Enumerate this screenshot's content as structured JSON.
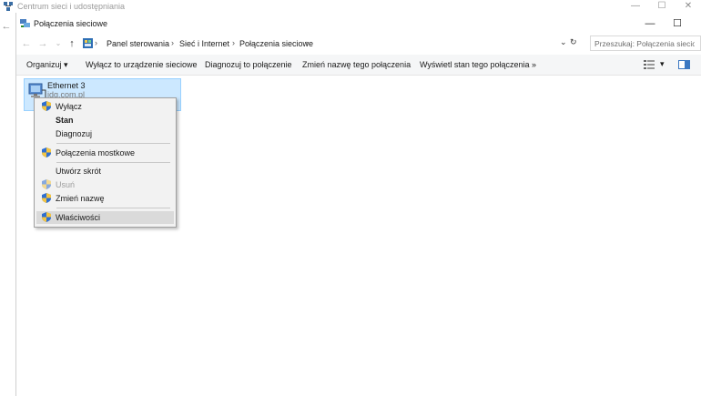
{
  "background_window": {
    "title": "Centrum sieci i udostępniania",
    "controls": [
      "—",
      "☐",
      "✕"
    ],
    "back": "←"
  },
  "window": {
    "title": "Połączenia sieciowe",
    "controls": [
      "—",
      "☐"
    ]
  },
  "nav": {
    "back": "←",
    "forward": "→",
    "recent": "⌄",
    "up": "↑"
  },
  "address": {
    "breadcrumbs": [
      "Panel sterowania",
      "Sieć i Internet",
      "Połączenia sieciowe"
    ],
    "separator": "›",
    "dropdown": "⌄",
    "refresh": "↻"
  },
  "search": {
    "placeholder": "Przeszukaj: Połączenia sieciowe"
  },
  "commandbar": {
    "organize": "Organizuj ▾",
    "items": [
      "Wyłącz to urządzenie sieciowe",
      "Diagnozuj to połączenie",
      "Zmień nazwę tego połączenia",
      "Wyświetl stan tego połączenia"
    ],
    "more": "»",
    "view_menu": "▾"
  },
  "connection": {
    "name": "Ethernet 3",
    "network": "idg.com.pl"
  },
  "context_menu": {
    "items": [
      {
        "label": "Wyłącz",
        "shield": true,
        "bold": false,
        "disabled": false
      },
      {
        "label": "Stan",
        "shield": false,
        "bold": true,
        "disabled": false
      },
      {
        "label": "Diagnozuj",
        "shield": false,
        "bold": false,
        "disabled": false
      },
      {
        "label": "Połączenia mostkowe",
        "shield": true,
        "bold": false,
        "disabled": false
      },
      {
        "label": "Utwórz skrót",
        "shield": false,
        "bold": false,
        "disabled": false
      },
      {
        "label": "Usuń",
        "shield": true,
        "bold": false,
        "disabled": true
      },
      {
        "label": "Zmień nazwę",
        "shield": true,
        "bold": false,
        "disabled": false
      },
      {
        "label": "Właściwości",
        "shield": true,
        "bold": false,
        "disabled": false,
        "highlighted": true
      }
    ]
  },
  "colors": {
    "selection_fill": "#cce8ff",
    "selection_border": "#99d1ff",
    "menu_bg": "#f2f2f2",
    "command_bar_bg": "#f5f6f7"
  }
}
